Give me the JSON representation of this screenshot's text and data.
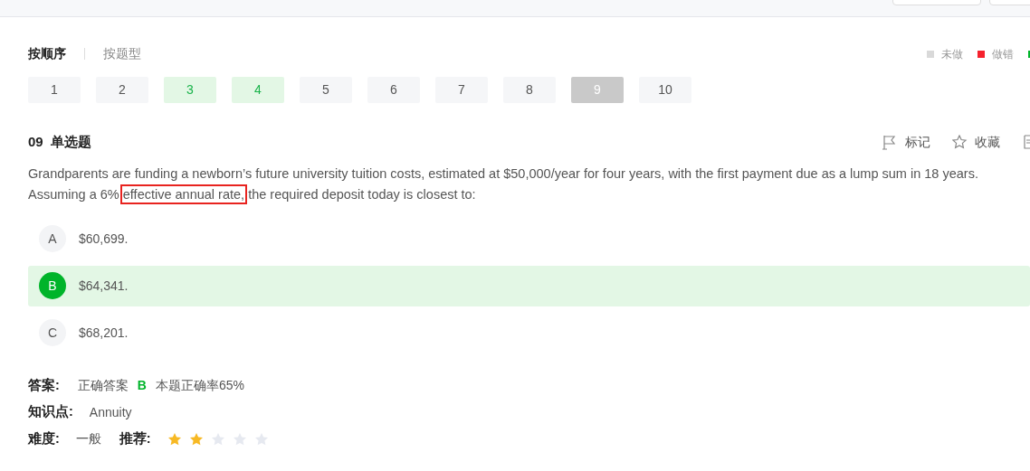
{
  "mode_tabs": [
    {
      "label": "按顺序",
      "selected": true
    },
    {
      "label": "按题型",
      "selected": false
    }
  ],
  "legend": [
    {
      "label": "未做",
      "color": "#d9d9d9"
    },
    {
      "label": "做错",
      "color": "#f5222d"
    },
    {
      "color": "#00b42a"
    }
  ],
  "numbers": [
    {
      "label": "1",
      "correct": false,
      "selected": false
    },
    {
      "label": "2",
      "correct": false,
      "selected": false
    },
    {
      "label": "3",
      "correct": true,
      "selected": false
    },
    {
      "label": "4",
      "correct": true,
      "selected": false
    },
    {
      "label": "5",
      "correct": false,
      "selected": false
    },
    {
      "label": "6",
      "correct": false,
      "selected": false
    },
    {
      "label": "7",
      "correct": false,
      "selected": false
    },
    {
      "label": "8",
      "correct": false,
      "selected": false
    },
    {
      "label": "9",
      "correct": false,
      "selected": true
    },
    {
      "label": "10",
      "correct": false,
      "selected": false
    }
  ],
  "question": {
    "number": "09",
    "type": "单选题",
    "actions": [
      {
        "label": "标记",
        "kind": "flag"
      },
      {
        "label": "收藏",
        "kind": "star"
      },
      {
        "kind": "doc"
      }
    ],
    "text": [
      {
        "text": "Grandparents are funding a newborn’s future university tuition costs, estimated at $50,000/year for four years, with the first payment due as a lump sum in 18 years. Assuming a 6% ",
        "boxed": false
      },
      {
        "text": "effective annual rate,",
        "boxed": true
      },
      {
        "text": " the required deposit today is closest to:",
        "boxed": false
      }
    ],
    "options": [
      {
        "letter": "A",
        "text": "$60,699.",
        "selected": false
      },
      {
        "letter": "B",
        "text": "$64,341.",
        "selected": true
      },
      {
        "letter": "C",
        "text": "$68,201.",
        "selected": false
      }
    ]
  },
  "answer": {
    "label": "答案:",
    "correct_label": "正确答案",
    "correct": "B",
    "rate": "本题正确率65%"
  },
  "knowledge": {
    "label": "知识点:",
    "value": "Annuity"
  },
  "difficulty": {
    "label": "难度:",
    "value": "一般"
  },
  "recommend": {
    "label": "推荐:",
    "stars": 2
  }
}
